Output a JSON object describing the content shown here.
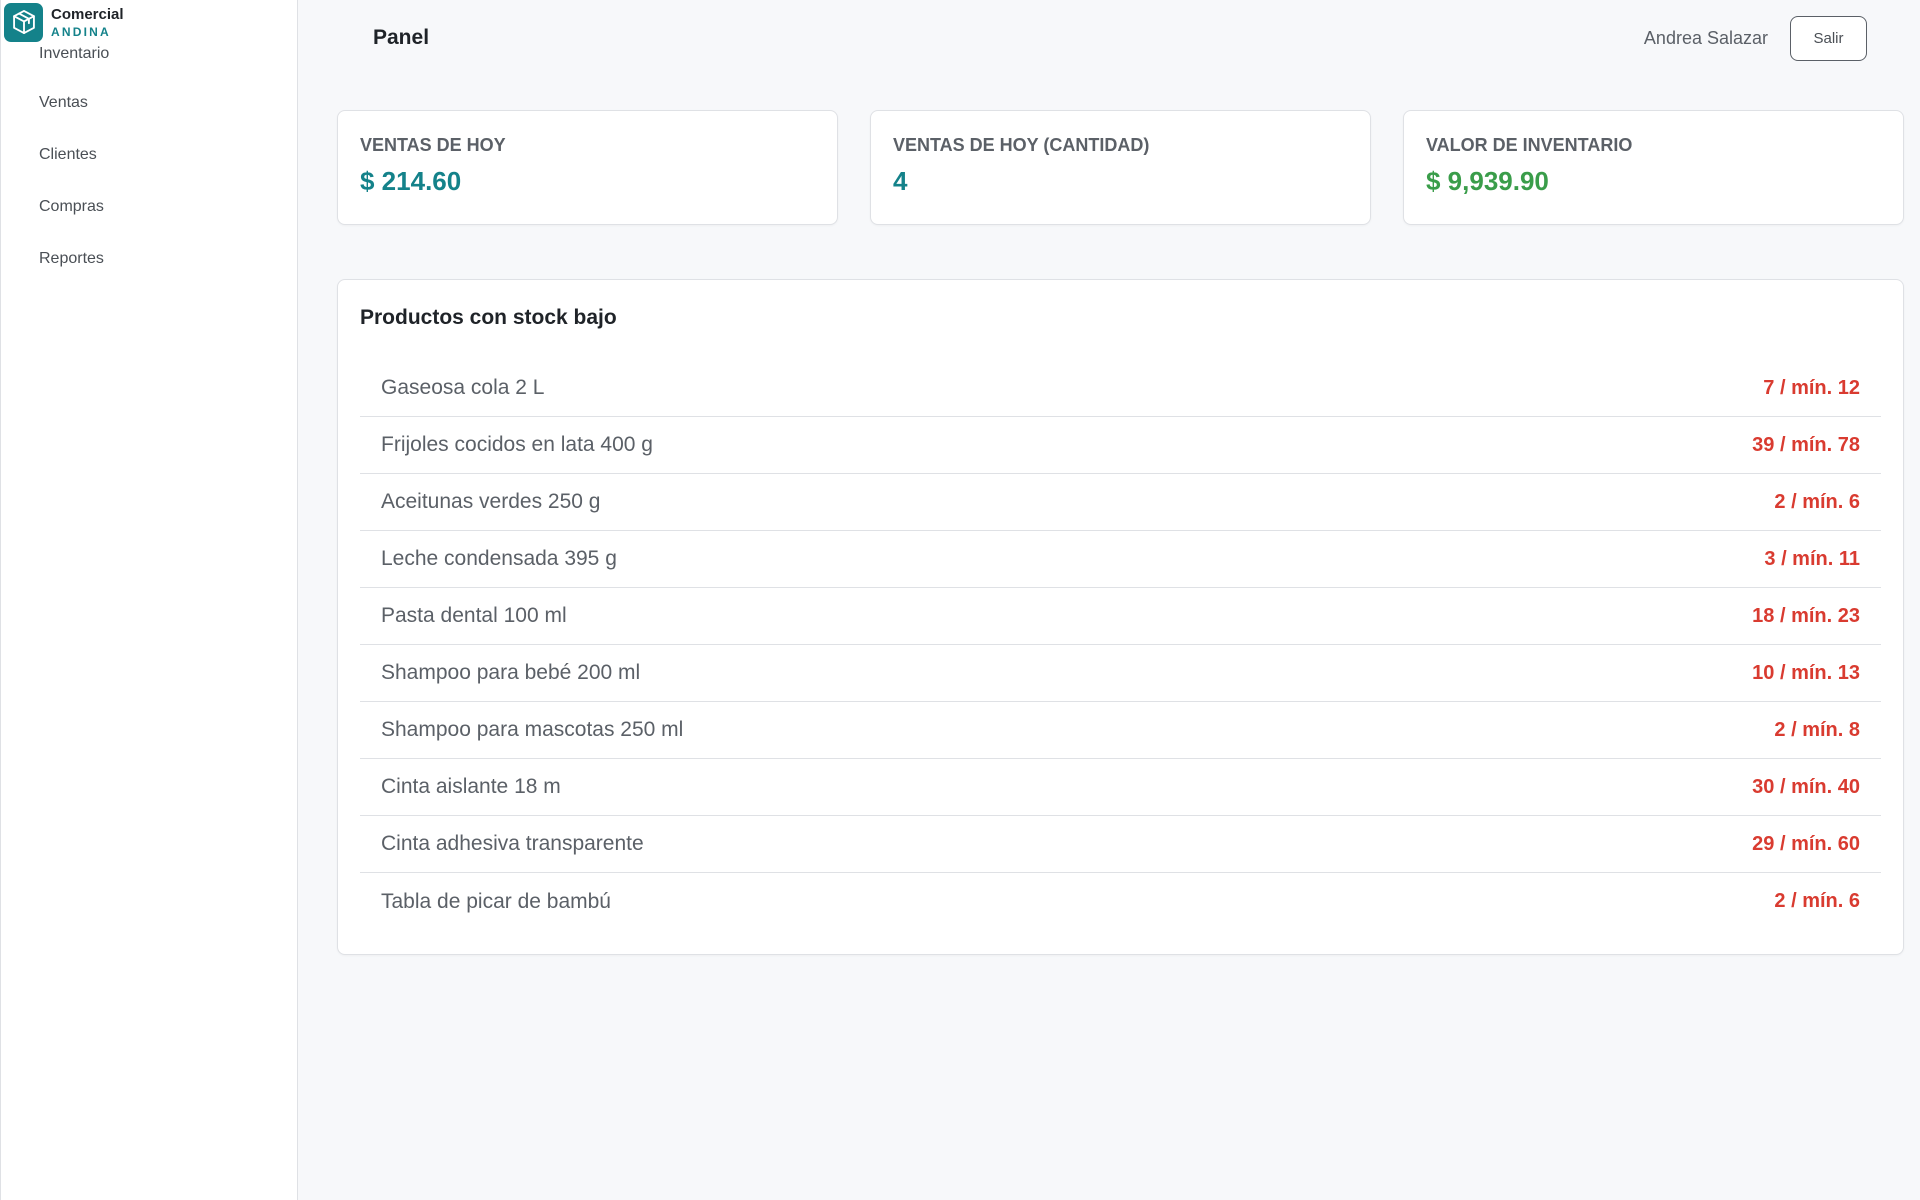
{
  "brand": {
    "name": "Comercial",
    "sub": "ANDINA",
    "accent": "#14828a",
    "icon": "box-icon"
  },
  "sidebar": {
    "items": [
      {
        "label": "Inventario"
      },
      {
        "label": "Ventas"
      },
      {
        "label": "Clientes"
      },
      {
        "label": "Compras"
      },
      {
        "label": "Reportes"
      }
    ]
  },
  "header": {
    "title": "Panel",
    "user": "Andrea Salazar",
    "logout_label": "Salir"
  },
  "stats": [
    {
      "label": "VENTAS DE HOY",
      "value": "$ 214.60",
      "color": "#14828a"
    },
    {
      "label": "VENTAS DE HOY (CANTIDAD)",
      "value": "4",
      "color": "#14828a"
    },
    {
      "label": "VALOR DE INVENTARIO",
      "value": "$ 9,939.90",
      "color": "#3a9d4a"
    }
  ],
  "low_stock": {
    "title": "Productos con stock bajo",
    "alert_color": "#d93b30",
    "items": [
      {
        "name": "Gaseosa cola 2 L",
        "qty": "7 / mín. 12"
      },
      {
        "name": "Frijoles cocidos en lata 400 g",
        "qty": "39 / mín. 78"
      },
      {
        "name": "Aceitunas verdes 250 g",
        "qty": "2 / mín. 6"
      },
      {
        "name": "Leche condensada 395 g",
        "qty": "3 / mín. 11"
      },
      {
        "name": "Pasta dental 100 ml",
        "qty": "18 / mín. 23"
      },
      {
        "name": "Shampoo para bebé 200 ml",
        "qty": "10 / mín. 13"
      },
      {
        "name": "Shampoo para mascotas 250 ml",
        "qty": "2 / mín. 8"
      },
      {
        "name": "Cinta aislante 18 m",
        "qty": "30 / mín. 40"
      },
      {
        "name": "Cinta adhesiva transparente",
        "qty": "29 / mín. 60"
      },
      {
        "name": "Tabla de picar de bambú",
        "qty": "2 / mín. 6"
      }
    ]
  }
}
